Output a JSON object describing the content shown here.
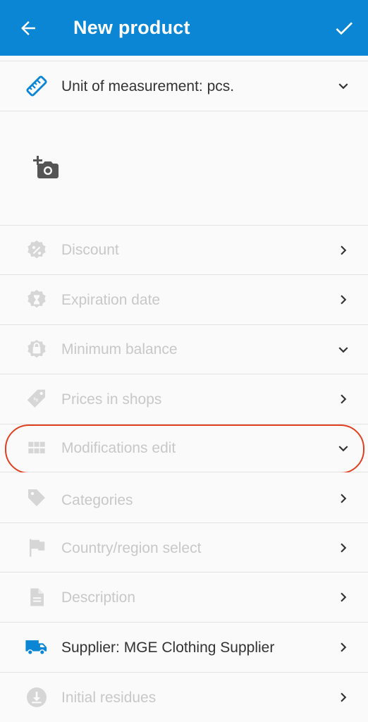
{
  "header": {
    "title": "New product",
    "background": "#0a86d4"
  },
  "unit_row": {
    "label": "Unit of measurement: pcs.",
    "icon": "ruler-icon",
    "icon_color": "#0a86d4"
  },
  "photo": {
    "icon": "add-photo-icon"
  },
  "rows": [
    {
      "label": "Discount",
      "icon": "discount-icon",
      "chevron": "right",
      "enabled": false
    },
    {
      "label": "Expiration date",
      "icon": "hourglass-icon",
      "chevron": "right",
      "enabled": false
    },
    {
      "label": "Minimum balance",
      "icon": "minimum-balance-icon",
      "chevron": "down",
      "enabled": false
    },
    {
      "label": "Prices in shops",
      "icon": "price-tag-icon",
      "chevron": "right",
      "enabled": false
    },
    {
      "label": "Modifications edit",
      "icon": "grid-icon",
      "chevron": "down",
      "enabled": false,
      "highlighted": true
    },
    {
      "label": "Categories",
      "icon": "label-icon",
      "chevron": "right",
      "enabled": false
    },
    {
      "label": "Country/region select",
      "icon": "flag-icon",
      "chevron": "right",
      "enabled": false
    },
    {
      "label": "Description",
      "icon": "document-icon",
      "chevron": "right",
      "enabled": false
    },
    {
      "label": "Supplier: MGE Clothing Supplier",
      "icon": "truck-icon",
      "chevron": "right",
      "enabled": true
    },
    {
      "label": "Initial residues",
      "icon": "download-icon",
      "chevron": "right",
      "enabled": false
    }
  ],
  "colors": {
    "disabled_icon": "#d6d6d6",
    "disabled_text": "#c8c8c8",
    "active_icon": "#0a86d4",
    "highlight": "#e0401f"
  }
}
